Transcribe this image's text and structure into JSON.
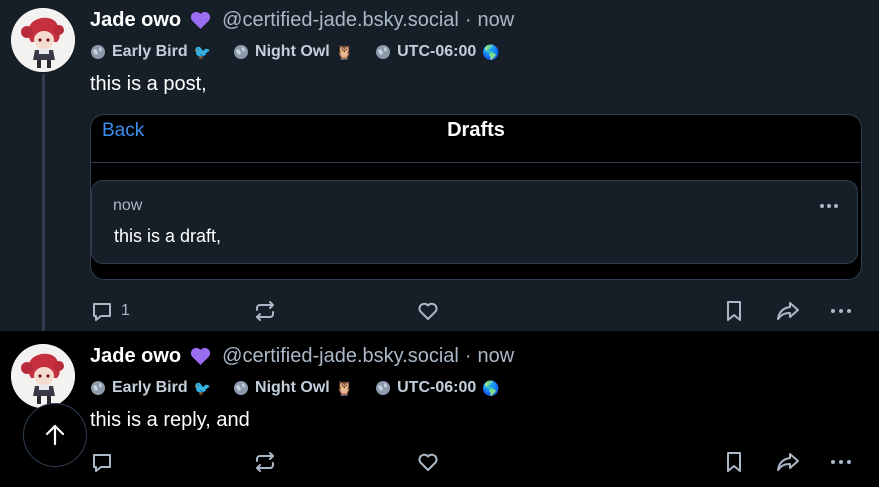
{
  "colors": {
    "background": "#000000",
    "highlighted_post_bg": "#161e27",
    "accent_blue": "#3b8ff0",
    "muted_text": "#aab8c8",
    "border": "#2e3d4f",
    "heart_purple": "#9b6df2"
  },
  "posts": [
    {
      "author": {
        "display_name": "Jade owo",
        "handle": "@certified-jade.bsky.social",
        "verified_icon": "purple-heart-icon"
      },
      "time": "now",
      "separator": "·",
      "badges": [
        {
          "label": "Early Bird",
          "emoji": "🐦"
        },
        {
          "label": "Night Owl",
          "emoji": "🦉"
        },
        {
          "label": "UTC-06:00",
          "emoji": "🌎"
        }
      ],
      "text": "this is a post,",
      "embed": {
        "back_label": "Back",
        "title": "Drafts",
        "draft": {
          "time": "now",
          "text": "this is a draft,",
          "more_icon": "more-horizontal-icon"
        }
      },
      "actions": {
        "reply_count": "1",
        "icons": [
          "reply-icon",
          "repost-icon",
          "like-icon",
          "bookmark-icon",
          "share-icon",
          "more-horizontal-icon"
        ]
      }
    },
    {
      "author": {
        "display_name": "Jade owo",
        "handle": "@certified-jade.bsky.social",
        "verified_icon": "purple-heart-icon"
      },
      "time": "now",
      "separator": "·",
      "badges": [
        {
          "label": "Early Bird",
          "emoji": "🐦"
        },
        {
          "label": "Night Owl",
          "emoji": "🦉"
        },
        {
          "label": "UTC-06:00",
          "emoji": "🌎"
        }
      ],
      "text": "this is a reply, and",
      "actions": {
        "icons": [
          "reply-icon",
          "repost-icon",
          "like-icon",
          "bookmark-icon",
          "share-icon",
          "more-horizontal-icon"
        ]
      }
    }
  ],
  "scroll_top": {
    "icon": "arrow-up-icon"
  }
}
